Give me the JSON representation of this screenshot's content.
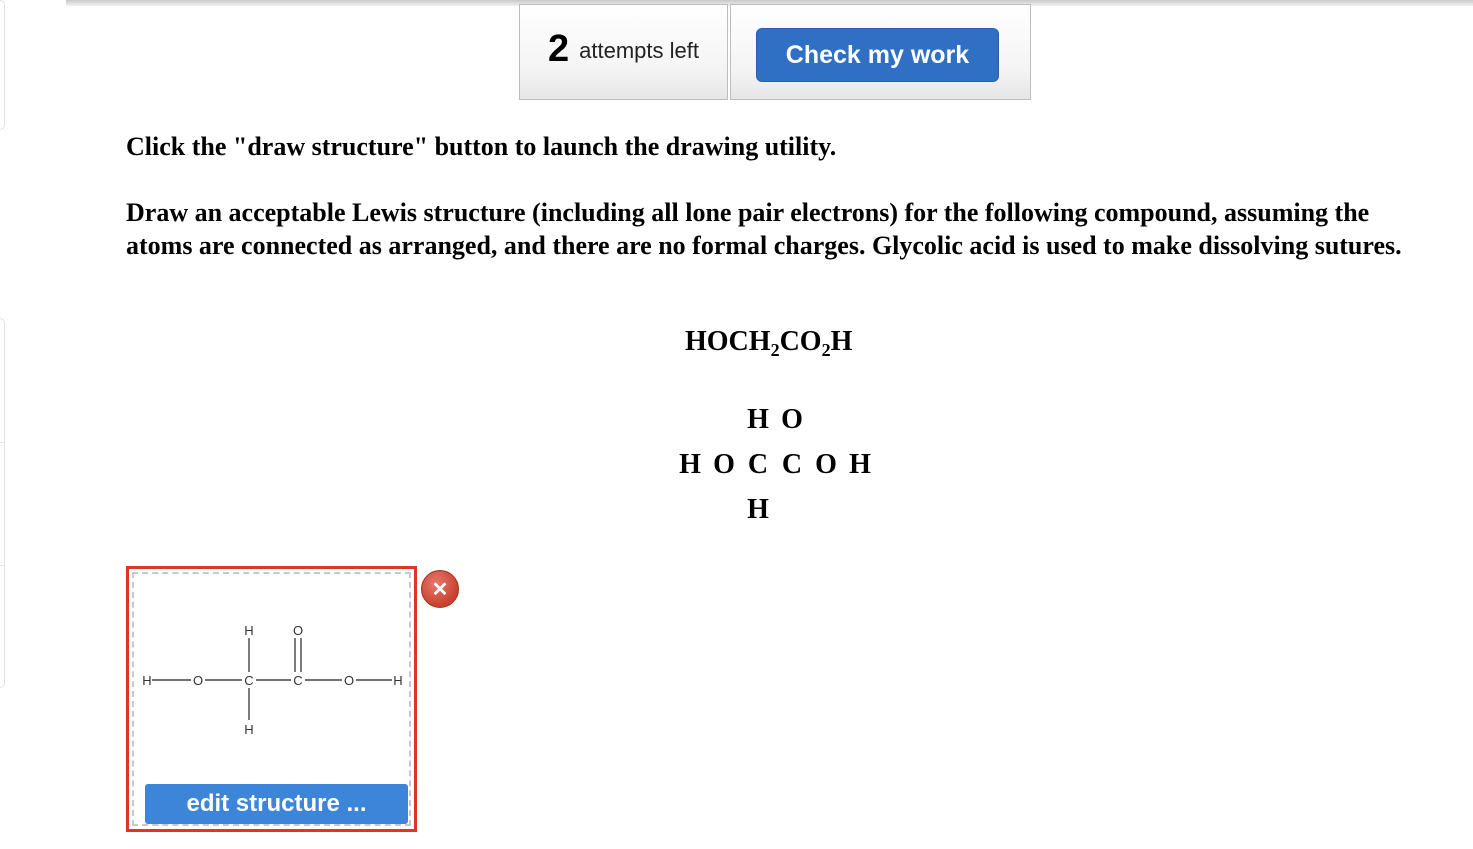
{
  "header": {
    "attempts_count": "2",
    "attempts_label": "attempts left",
    "check_button_label": "Check my work"
  },
  "question": {
    "instruction_1": "Click the \"draw structure\" button to launch the drawing utility.",
    "instruction_2": "Draw an acceptable Lewis structure (including all lone pair electrons) for the following compound, assuming the atoms are connected as arranged, and there are no formal charges. Glycolic acid is used to make dissolving sutures.",
    "formula": {
      "p1": "HOCH",
      "s1": "2",
      "p2": "CO",
      "s2": "2",
      "p3": "H"
    },
    "atom_grid": {
      "row_top": [
        "H",
        "O"
      ],
      "row_middle": [
        "H",
        "O",
        "C",
        "C",
        "O",
        "H"
      ],
      "row_bottom": [
        "H"
      ]
    }
  },
  "structure_panel": {
    "edit_button_label": "edit structure ...",
    "remove_icon": "x-close-icon",
    "molecule_atoms": {
      "h_left": "H",
      "o_left": "O",
      "c_one": "C",
      "c_two": "C",
      "o_right": "O",
      "h_right": "H",
      "h_top": "H",
      "o_top": "O",
      "h_bottom": "H"
    }
  }
}
